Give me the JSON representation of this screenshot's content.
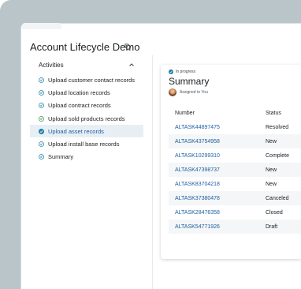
{
  "page": {
    "title": "Account Lifecycle Demo"
  },
  "activities": {
    "title": "Activities",
    "items": [
      {
        "label": "Upload customer contact records",
        "state": "in-progress",
        "selected": false
      },
      {
        "label": "Upload location records",
        "state": "in-progress",
        "selected": false
      },
      {
        "label": "Upload contract records",
        "state": "in-progress",
        "selected": false
      },
      {
        "label": "Upload sold products records",
        "state": "complete",
        "selected": false
      },
      {
        "label": "Upload asset records",
        "state": "in-progress",
        "selected": true
      },
      {
        "label": "Upload install base records",
        "state": "in-progress",
        "selected": false
      },
      {
        "label": "Summary",
        "state": "in-progress",
        "selected": false
      }
    ]
  },
  "card": {
    "status": "In progress",
    "title": "Summary",
    "assigned": "Assigned to You"
  },
  "table": {
    "columns": [
      "Number",
      "Status"
    ],
    "rows": [
      {
        "number": "ALTASK44897475",
        "status": "Resolved"
      },
      {
        "number": "ALTASK43754958",
        "status": "New"
      },
      {
        "number": "ALTASK10299310",
        "status": "Complete"
      },
      {
        "number": "ALTASK47398737",
        "status": "New"
      },
      {
        "number": "ALTASK83704218",
        "status": "New"
      },
      {
        "number": "ALTASK37380478",
        "status": "Canceled"
      },
      {
        "number": "ALTASK28476358",
        "status": "Closed"
      },
      {
        "number": "ALTASK54771926",
        "status": "Draft"
      }
    ]
  },
  "colors": {
    "in_progress": "#1e7fa8",
    "complete": "#3d8f4a",
    "link": "#1e5fa3"
  }
}
